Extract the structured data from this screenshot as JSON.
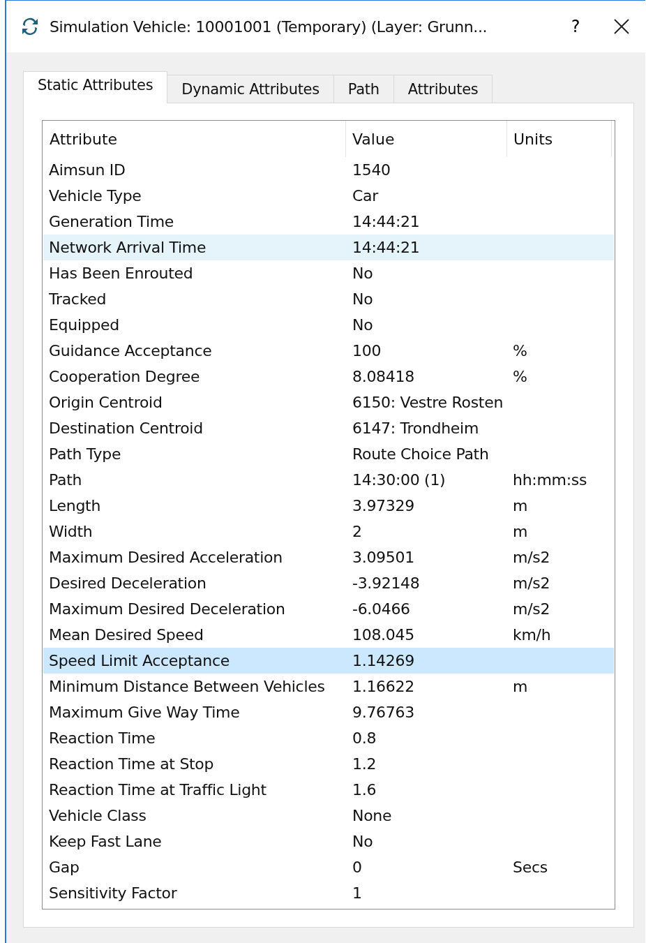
{
  "window": {
    "title": "Simulation Vehicle: 10001001 (Temporary) (Layer: Grunn...",
    "help": "?"
  },
  "tabs": [
    {
      "label": "Static Attributes",
      "selected": true
    },
    {
      "label": "Dynamic Attributes",
      "selected": false
    },
    {
      "label": "Path",
      "selected": false
    },
    {
      "label": "Attributes",
      "selected": false
    }
  ],
  "table": {
    "columns": [
      "Attribute",
      "Value",
      "Units"
    ],
    "rows": [
      {
        "attribute": "Aimsun ID",
        "value": "1540",
        "units": "",
        "hovered": false,
        "selected": false
      },
      {
        "attribute": "Vehicle Type",
        "value": "Car",
        "units": "",
        "hovered": false,
        "selected": false
      },
      {
        "attribute": "Generation Time",
        "value": "14:44:21",
        "units": "",
        "hovered": false,
        "selected": false
      },
      {
        "attribute": "Network Arrival Time",
        "value": "14:44:21",
        "units": "",
        "hovered": true,
        "selected": false
      },
      {
        "attribute": "Has Been Enrouted",
        "value": "No",
        "units": "",
        "hovered": false,
        "selected": false
      },
      {
        "attribute": "Tracked",
        "value": "No",
        "units": "",
        "hovered": false,
        "selected": false
      },
      {
        "attribute": "Equipped",
        "value": "No",
        "units": "",
        "hovered": false,
        "selected": false
      },
      {
        "attribute": "Guidance Acceptance",
        "value": "100",
        "units": "%",
        "hovered": false,
        "selected": false
      },
      {
        "attribute": "Cooperation Degree",
        "value": "8.08418",
        "units": "%",
        "hovered": false,
        "selected": false
      },
      {
        "attribute": "Origin Centroid",
        "value": "6150: Vestre Rosten",
        "units": "",
        "hovered": false,
        "selected": false
      },
      {
        "attribute": "Destination Centroid",
        "value": "6147: Trondheim",
        "units": "",
        "hovered": false,
        "selected": false
      },
      {
        "attribute": "Path Type",
        "value": "Route Choice Path",
        "units": "",
        "hovered": false,
        "selected": false
      },
      {
        "attribute": "Path",
        "value": "14:30:00 (1)",
        "units": "hh:mm:ss",
        "hovered": false,
        "selected": false
      },
      {
        "attribute": "Length",
        "value": "3.97329",
        "units": "m",
        "hovered": false,
        "selected": false
      },
      {
        "attribute": "Width",
        "value": "2",
        "units": "m",
        "hovered": false,
        "selected": false
      },
      {
        "attribute": "Maximum Desired Acceleration",
        "value": "3.09501",
        "units": "m/s2",
        "hovered": false,
        "selected": false
      },
      {
        "attribute": "Desired Deceleration",
        "value": "-3.92148",
        "units": "m/s2",
        "hovered": false,
        "selected": false
      },
      {
        "attribute": "Maximum Desired Deceleration",
        "value": "-6.0466",
        "units": "m/s2",
        "hovered": false,
        "selected": false
      },
      {
        "attribute": "Mean Desired Speed",
        "value": "108.045",
        "units": "km/h",
        "hovered": false,
        "selected": false
      },
      {
        "attribute": "Speed Limit Acceptance",
        "value": "1.14269",
        "units": "",
        "hovered": false,
        "selected": true
      },
      {
        "attribute": "Minimum Distance Between Vehicles",
        "value": "1.16622",
        "units": "m",
        "hovered": false,
        "selected": false
      },
      {
        "attribute": "Maximum Give Way Time",
        "value": "9.76763",
        "units": "",
        "hovered": false,
        "selected": false
      },
      {
        "attribute": "Reaction Time",
        "value": "0.8",
        "units": "",
        "hovered": false,
        "selected": false
      },
      {
        "attribute": "Reaction Time at Stop",
        "value": "1.2",
        "units": "",
        "hovered": false,
        "selected": false
      },
      {
        "attribute": "Reaction Time at Traffic Light",
        "value": "1.6",
        "units": "",
        "hovered": false,
        "selected": false
      },
      {
        "attribute": "Vehicle Class",
        "value": "None",
        "units": "",
        "hovered": false,
        "selected": false
      },
      {
        "attribute": "Keep Fast Lane",
        "value": "No",
        "units": "",
        "hovered": false,
        "selected": false
      },
      {
        "attribute": "Gap",
        "value": "0",
        "units": "Secs",
        "hovered": false,
        "selected": false
      },
      {
        "attribute": "Sensitivity Factor",
        "value": "1",
        "units": "",
        "hovered": false,
        "selected": false
      }
    ]
  }
}
